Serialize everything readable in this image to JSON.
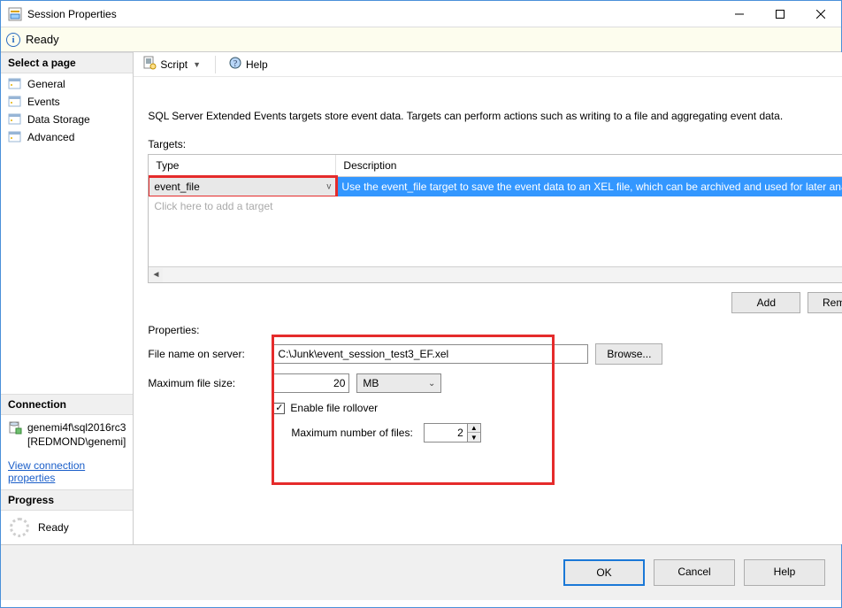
{
  "window": {
    "title": "Session Properties"
  },
  "status": {
    "text": "Ready"
  },
  "sidebar": {
    "section_page": "Select a page",
    "items": [
      {
        "label": "General"
      },
      {
        "label": "Events"
      },
      {
        "label": "Data Storage"
      },
      {
        "label": "Advanced"
      }
    ],
    "section_conn": "Connection",
    "conn_server": "genemi4f\\sql2016rc3",
    "conn_user": "[REDMOND\\genemi]",
    "conn_link": "View connection properties",
    "section_progress": "Progress",
    "progress_text": "Ready"
  },
  "toolbar": {
    "script": "Script",
    "help": "Help"
  },
  "main": {
    "intro": "SQL Server Extended Events targets store event data. Targets can perform actions such as writing to a file and aggregating event data.",
    "targets_label": "Targets:",
    "th_type": "Type",
    "th_desc": "Description",
    "row_type": "event_file",
    "row_desc": "Use the event_file target to save the event data to an XEL file, which can be archived and used for later analysis.",
    "row_placeholder": "Click here to add a target",
    "btn_add": "Add",
    "btn_remove": "Remove",
    "properties_label": "Properties:",
    "lbl_file": "File name on server:",
    "val_file": "C:\\Junk\\event_session_test3_EF.xel",
    "btn_browse": "Browse...",
    "lbl_maxsize": "Maximum file size:",
    "val_maxsize": "20",
    "unit_maxsize": "MB",
    "lbl_rollover": "Enable file rollover",
    "lbl_maxfiles": "Maximum number of files:",
    "val_maxfiles": "2"
  },
  "footer": {
    "ok": "OK",
    "cancel": "Cancel",
    "help": "Help"
  }
}
